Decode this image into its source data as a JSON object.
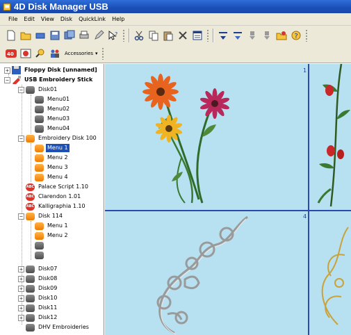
{
  "window": {
    "title": "4D Disk Manager USB"
  },
  "menu": [
    "File",
    "Edit",
    "View",
    "Disk",
    "QuickLink",
    "Help"
  ],
  "toolbar": {
    "accessories_label": "Accessories"
  },
  "tree": {
    "root1": "Floppy Disk [unnamed]",
    "root2": "USB Embroidery Stick",
    "disk01": "Disk01",
    "menu01": "Menu01",
    "menu02": "Menu02",
    "menu03": "Menu03",
    "menu04": "Menu04",
    "emb100": "Embroidery Disk 100",
    "m1": "Menu 1",
    "m2": "Menu 2",
    "m3": "Menu 3",
    "m4": "Menu 4",
    "font1": "Palace Script  1.10",
    "font2": "Clarendon  1.01",
    "font3": "Kalligraphia  1.10",
    "disk114": "Disk 114",
    "d114m1": "Menu 1",
    "d114m2": "Menu 2",
    "disk07": "Disk07",
    "disk08": "Disk08",
    "disk09": "Disk09",
    "disk10": "Disk10",
    "disk11": "Disk11",
    "disk12": "Disk12",
    "dhv": "DHV Embroideries"
  },
  "canvas": {
    "cell1_num": "1",
    "cell4_num": "4"
  }
}
